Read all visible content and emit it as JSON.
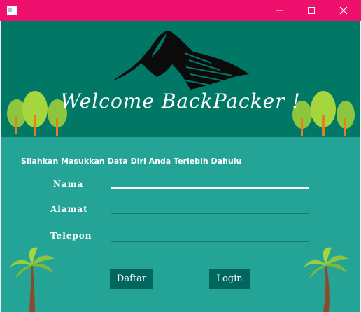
{
  "window": {
    "title": "",
    "controls": {
      "minimize": "—",
      "maximize": "☐",
      "close": "✕"
    },
    "titlebar_color": "#ef0f6c"
  },
  "header": {
    "headline": "Welcome BackPacker !",
    "background": "#017766"
  },
  "form": {
    "instruction": "Silahkan Masukkan Data Diri Anda Terlebih Dahulu",
    "fields": [
      {
        "label": "Nama",
        "value": ""
      },
      {
        "label": "Alamat",
        "value": ""
      },
      {
        "label": "Telepon",
        "value": ""
      }
    ],
    "buttons": {
      "register": "Daftar",
      "login": "Login"
    },
    "background": "#24a496"
  }
}
